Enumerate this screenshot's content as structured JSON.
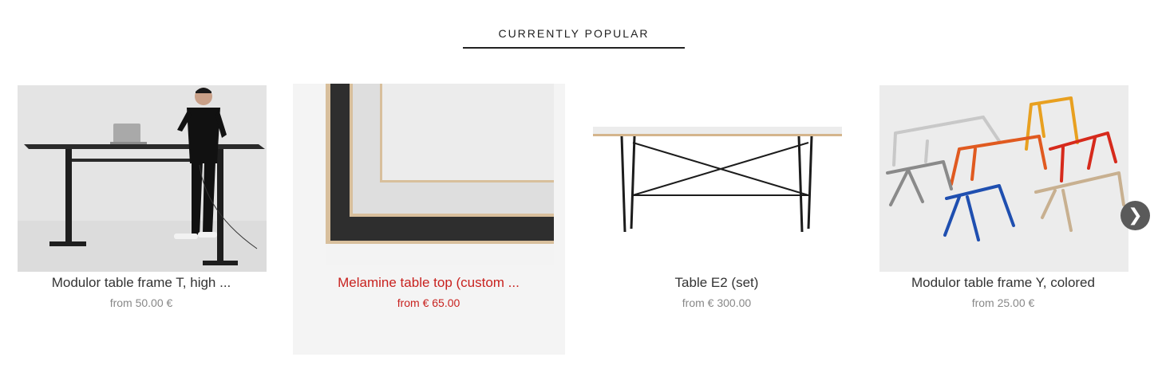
{
  "section": {
    "title": "CURRENTLY POPULAR"
  },
  "products": [
    {
      "name": "Modulor table frame T, high ...",
      "price": "from 50.00 €",
      "image": "standing-desk-photo"
    },
    {
      "name": "Melamine table top (custom ...",
      "price": "from € 65.00",
      "image": "melamine-table-top-photo"
    },
    {
      "name": "Table E2 (set)",
      "price": "from € 300.00",
      "image": "table-e2-photo"
    },
    {
      "name": "Modulor table frame Y, colored",
      "price": "from 25.00 €",
      "image": "colored-y-frames-photo"
    }
  ],
  "carousel": {
    "next_icon": "chevron-right-icon",
    "next_glyph": "❯"
  },
  "colors": {
    "hover_text": "#c8221f",
    "price_text": "#888888",
    "button_bg": "#5a5a5a"
  }
}
